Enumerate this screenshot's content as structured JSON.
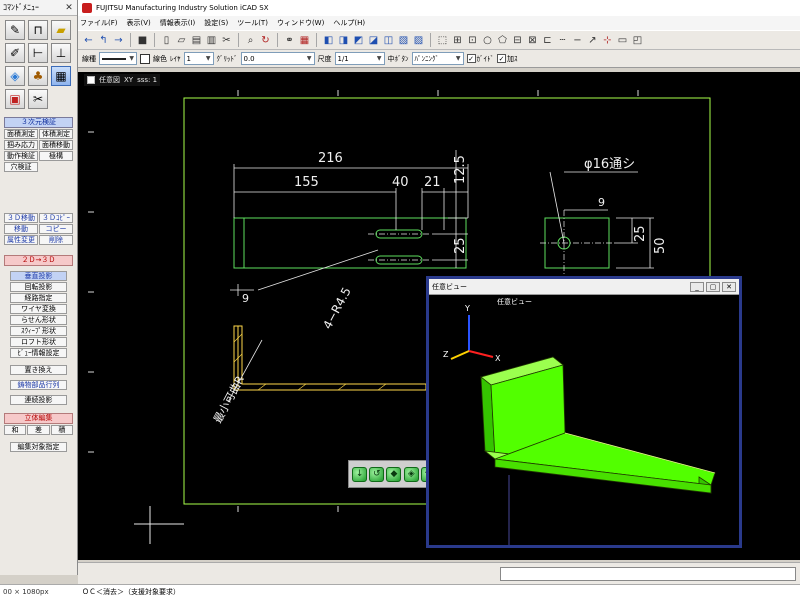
{
  "cmd_panel": {
    "title": "ｺﾏﾝﾄﾞﾒﾆｭｰ",
    "close": "✕",
    "icons": [
      "pencil-icon",
      "frame-icon",
      "folder-icon",
      "probe-icon",
      "ruler-icon",
      "tune-icon",
      "cube-icon",
      "tree-icon",
      "mesh-icon",
      "doc-icon",
      "brush-icon"
    ],
    "sections": {
      "verify": "３次元検証",
      "move": "３Ｄ移動",
      "copy": "３Ｄｺﾋﾟｰ",
      "conv": "２Ｄ→３Ｄ",
      "solid": "立体編集"
    },
    "verify_rows": [
      [
        "面積測定",
        "体積測定"
      ],
      [
        "掴み応力",
        "面積移動"
      ],
      [
        "動作検証",
        "極構"
      ],
      [
        "穴検証"
      ]
    ],
    "move_rows": [
      [
        "移動",
        "コピー"
      ],
      [
        "属性変更",
        "削除"
      ]
    ],
    "conv_items": [
      "垂直投影",
      "回転投影",
      "経路指定",
      "ワイヤ変換",
      "らせん形状",
      "ｽｳｨｰﾌﾟ形状",
      "ロフト形状",
      "ﾋﾞｭｰ情報設定"
    ],
    "single_items": [
      "置き換え",
      "鋳物部品行列",
      "連続投影"
    ],
    "solid_row": [
      "和",
      "差",
      "積"
    ],
    "last_item": "編集対象指定"
  },
  "app": {
    "title": "FUJITSU Manufacturing Industry Solution iCAD SX",
    "menus": [
      "ファイル(F)",
      "表示(V)",
      "情報表示(I)",
      "設定(S)",
      "ツール(T)",
      "ウィンドウ(W)",
      "ヘルプ(H)"
    ],
    "toolbar2": {
      "line_type_label": "線種",
      "line_color_label": "線色",
      "layer_label": "ﾚｲﾔ",
      "layer_value": "1",
      "grid_label": "ｸﾞﾘｯﾄﾞ",
      "grid_value": "0.0",
      "scale_label": "尺度",
      "scale_value": "1/1",
      "center_label": "中ﾎﾞﾀﾝ",
      "center_value": "ﾊﾟﾝﾆﾝｸﾞ",
      "check1": "ｶﾞｲﾄﾞ",
      "check2": "加ｽ"
    }
  },
  "view": {
    "name": "任意図",
    "coord_label": "XY",
    "extra": "sss: 1"
  },
  "drawing": {
    "dim_216": "216",
    "dim_155": "155",
    "dim_40": "40",
    "dim_21": "21",
    "dim_12_5": "12.5",
    "dim_25a": "25",
    "dim_9a": "9",
    "dim_hole": "4−R4.5",
    "dim_phi": "φ16通シ",
    "dim_9b": "9",
    "dim_25b": "25",
    "dim_50": "50",
    "min_bend": "最小可曲R"
  },
  "float_view": {
    "title": "任意ビュー",
    "caption": "任意ビュー",
    "buttons": [
      "_",
      "▢",
      "✕"
    ],
    "axis_labels": [
      "Z",
      "X",
      "Y"
    ]
  },
  "status": {
    "message": "ＯＣ＜消去＞（支援対象要求）",
    "resolution": "00 × 1080px"
  },
  "colors": {
    "background": "#000000",
    "drawing_lines": "#5ee05e",
    "dimension_lines": "#e8e8e8",
    "frame": "#a8ff4a",
    "solid_face": "#52ff00",
    "float_border": "#2a3a8c"
  }
}
